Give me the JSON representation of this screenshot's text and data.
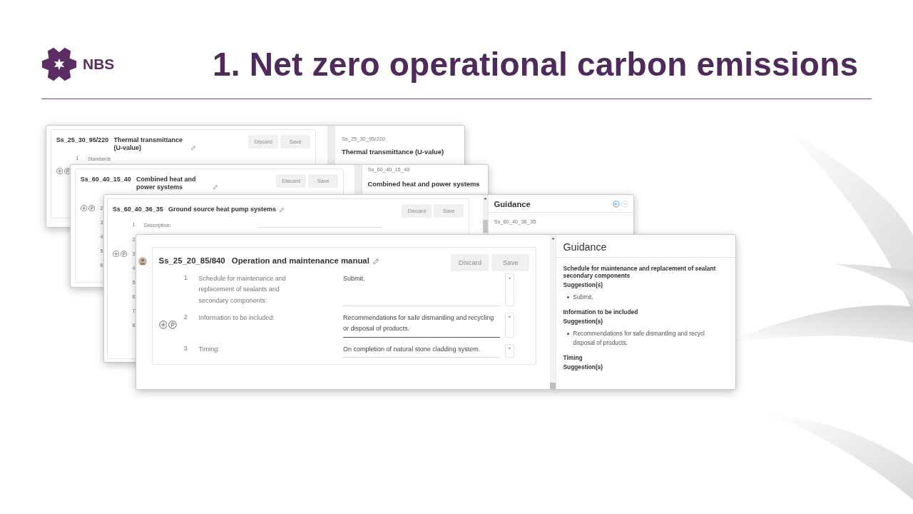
{
  "slide": {
    "logo_text": "NBS",
    "title": "1. Net zero operational carbon emissions"
  },
  "windows": [
    {
      "code": "Ss_25_30_95/220",
      "title": "Thermal transmittance (U-value)",
      "buttons": [
        "Discard",
        "Save"
      ],
      "scrollbar": false,
      "avatar": false,
      "rows": [
        {
          "kind": "plain",
          "number": "1",
          "label": "Standards",
          "tools": false
        },
        {
          "kind": "plain",
          "tools": true
        }
      ],
      "side": {
        "code": "Ss_25_30_95/220",
        "title": "Thermal transmittance (U-value)"
      }
    },
    {
      "code": "Ss_60_40_15_40",
      "title": "Combined heat and power systems",
      "buttons": [
        "Discard",
        "Save"
      ],
      "scrollbar": false,
      "avatar": false,
      "rows": [
        {
          "kind": "plain",
          "number": "2",
          "tools": true
        },
        {
          "kind": "plain",
          "number": "3",
          "tools": false
        },
        {
          "kind": "plain",
          "number": "4",
          "tools": false
        },
        {
          "kind": "plain",
          "number": "5",
          "tools": false
        },
        {
          "kind": "plain",
          "number": "6",
          "tools": false
        }
      ],
      "side": {
        "code": "Ss_60_40_15_40",
        "title": "Combined heat and power systems"
      }
    },
    {
      "code": "Ss_60_40_36_35",
      "title": "Ground source heat pump systems",
      "buttons": [
        "Discard",
        "Save"
      ],
      "scrollbar": true,
      "avatar": false,
      "rows": [
        {
          "kind": "field",
          "number": "1",
          "label": "Description:",
          "tools": false
        },
        {
          "kind": "plain",
          "number": "2",
          "tools": false
        },
        {
          "kind": "plain",
          "number": "3",
          "tools": true
        },
        {
          "kind": "plain",
          "number": "4",
          "tools": false
        },
        {
          "kind": "plain",
          "number": "5",
          "tools": false
        },
        {
          "kind": "plain",
          "number": "6",
          "tools": false
        },
        {
          "kind": "plain",
          "number": "7",
          "tools": false
        },
        {
          "kind": "plain",
          "number": "8",
          "tools": false
        }
      ],
      "side": {
        "heading": "Guidance",
        "nav": [
          {
            "kind": "back",
            "disabled": false
          },
          {
            "kind": "forward",
            "disabled": true
          }
        ],
        "code": "Ss_60_40_36_35"
      }
    },
    {
      "code": "Ss_25_20_85/840",
      "title": "Operation and maintenance manual",
      "buttons": [
        "Discard",
        "Save"
      ],
      "scrollbar": true,
      "avatar": true,
      "rows": [
        {
          "kind": "select",
          "number": "1",
          "label": "Schedule for maintenance and replacement of sealants and secondary components:",
          "value": "Submit.",
          "focused": false,
          "tools": false
        },
        {
          "kind": "select",
          "number": "2",
          "label": "Information to be included:",
          "value": "Recommendations for safe dismantling and recycling or disposal of products.",
          "focused": true,
          "tools": true
        },
        {
          "kind": "select",
          "number": "3",
          "label": "Timing:",
          "value": "On completion of natural stone cladding system.",
          "focused": false,
          "tools": false
        }
      ],
      "side": {
        "heading": "Guidance",
        "sections": [
          {
            "heading": "Schedule for maintenance and replacement of sealant\nsecondary components",
            "label": "Suggestion(s)",
            "items": [
              "Submit."
            ]
          },
          {
            "heading": "Information to be included",
            "label": "Suggestion(s)",
            "items": [
              "Recommendations for safe dismantling and recycl\ndisposal of products."
            ]
          },
          {
            "heading": "Timing",
            "label": "Suggestion(s)"
          }
        ]
      }
    }
  ]
}
